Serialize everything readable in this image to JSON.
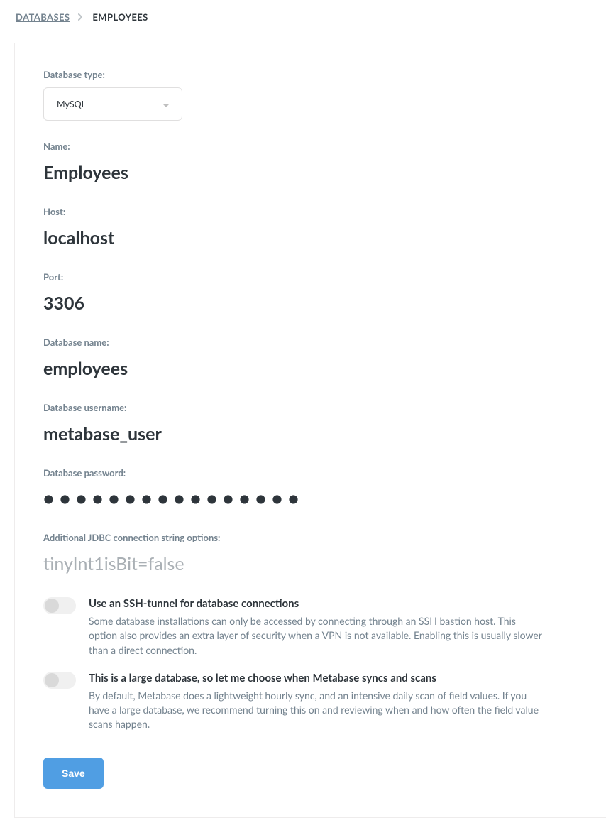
{
  "breadcrumb": {
    "root": "DATABASES",
    "current": "EMPLOYEES"
  },
  "form": {
    "db_type": {
      "label": "Database type:",
      "value": "MySQL"
    },
    "name": {
      "label": "Name:",
      "value": "Employees"
    },
    "host": {
      "label": "Host:",
      "value": "localhost"
    },
    "port": {
      "label": "Port:",
      "value": "3306"
    },
    "dbname": {
      "label": "Database name:",
      "value": "employees"
    },
    "username": {
      "label": "Database username:",
      "value": "metabase_user"
    },
    "password": {
      "label": "Database password:",
      "masked": "●●●●●●●●●●●●●●●●"
    },
    "jdbc": {
      "label": "Additional JDBC connection string options:",
      "placeholder": "tinyInt1isBit=false"
    }
  },
  "toggles": {
    "ssh": {
      "title": "Use an SSH-tunnel for database connections",
      "desc": "Some database installations can only be accessed by connecting through an SSH bastion host. This option also provides an extra layer of security when a VPN is not available. Enabling this is usually slower than a direct connection."
    },
    "large": {
      "title": "This is a large database, so let me choose when Metabase syncs and scans",
      "desc": "By default, Metabase does a lightweight hourly sync, and an intensive daily scan of field values. If you have a large database, we recommend turning this on and reviewing when and how often the field value scans happen."
    }
  },
  "actions": {
    "save": "Save"
  }
}
